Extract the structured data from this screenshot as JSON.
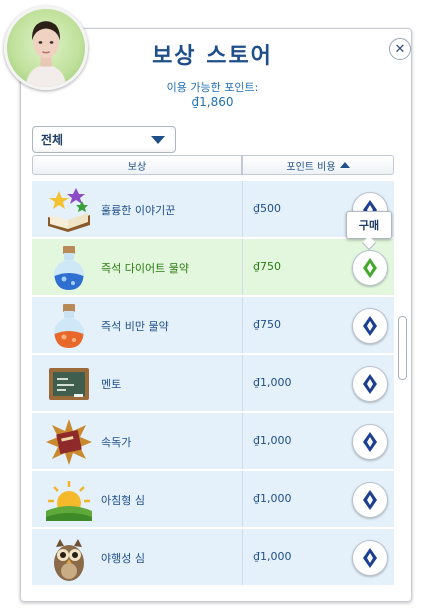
{
  "title": "보상 스토어",
  "points_label": "이용 가능한 포인트:",
  "points_value": "₫1,860",
  "filter": {
    "selected": "전체"
  },
  "columns": {
    "reward": "보상",
    "cost": "포인트 비용"
  },
  "tooltip": "구매",
  "close_icon": "close-icon",
  "colors": {
    "accent": "#1f4f8a",
    "highlight_row": "#e2f7dd",
    "row": "#e4f0fa",
    "buy_selected": "#43a82c"
  },
  "rewards": [
    {
      "name": "훌륭한 이야기꾼",
      "cost": "₫500",
      "icon": "storybook-icon",
      "highlighted": false
    },
    {
      "name": "즉석 다이어트 물약",
      "cost": "₫750",
      "icon": "blue-potion-icon",
      "highlighted": true
    },
    {
      "name": "즉석 비만 물약",
      "cost": "₫750",
      "icon": "orange-potion-icon",
      "highlighted": false
    },
    {
      "name": "멘토",
      "cost": "₫1,000",
      "icon": "chalkboard-icon",
      "highlighted": false
    },
    {
      "name": "속독가",
      "cost": "₫1,000",
      "icon": "speed-book-icon",
      "highlighted": false
    },
    {
      "name": "아침형 심",
      "cost": "₫1,000",
      "icon": "sunrise-icon",
      "highlighted": false
    },
    {
      "name": "야행성 심",
      "cost": "₫1,000",
      "icon": "owl-icon",
      "highlighted": false
    }
  ]
}
